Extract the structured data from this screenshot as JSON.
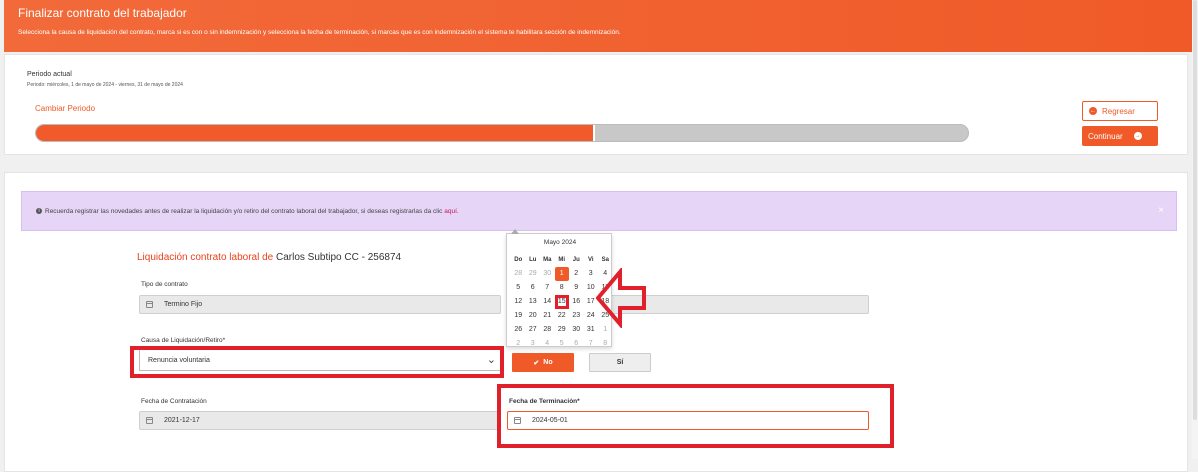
{
  "header": {
    "title": "Finalizar contrato del trabajador",
    "subtitle": "Selecciona la causa de liquidación del contrato, marca si es con o sin indemnización y selecciona la fecha de terminación, si marcas que es con indemnización el sistema te habilitara sección de indemnización."
  },
  "periodo": {
    "label": "Periodo actual",
    "range": "Periodo: miércoles, 1 de mayo de 2024 - viernes, 31 de mayo de 2024",
    "cambiar": "Cambiar Periodo",
    "progress_fraction": 0.6
  },
  "actions": {
    "regresar": "Regresar",
    "continuar": "Continuar"
  },
  "notice": {
    "text": "Recuerda registrar las novedades antes de realizar la liquidación y/o retiro del contrato laboral del trabajador, si deseas registrarlas da clic ",
    "link": "aquí",
    "tail": ".",
    "close": "×"
  },
  "liquidacion": {
    "title_prefix": "Liquidación contrato laboral de",
    "worker": "Carlos Subtipo CC - 256874"
  },
  "form": {
    "tipo_label": "Tipo de contrato",
    "tipo_value": "Termino Fijo",
    "causa_label": "Causa de Liquidación/Retiro*",
    "causa_value": "Renuncia voluntaria",
    "no_label": "No",
    "si_label": "Sí",
    "contratacion_label": "Fecha de Contratación",
    "contratacion_value": "2021-12-17",
    "terminacion_label": "Fecha de Terminación*",
    "terminacion_value": "2024-05-01"
  },
  "calendar": {
    "month": "Mayo 2024",
    "weekdays": [
      "Do",
      "Lu",
      "Ma",
      "Mi",
      "Ju",
      "Vi",
      "Sa"
    ],
    "days": [
      [
        "28",
        "29",
        "30",
        "1",
        "2",
        "3",
        "4"
      ],
      [
        "5",
        "6",
        "7",
        "8",
        "9",
        "10",
        "11"
      ],
      [
        "12",
        "13",
        "14",
        "15",
        "16",
        "17",
        "18"
      ],
      [
        "19",
        "20",
        "21",
        "22",
        "23",
        "24",
        "25"
      ],
      [
        "26",
        "27",
        "28",
        "29",
        "30",
        "31",
        "1"
      ],
      [
        "2",
        "3",
        "4",
        "5",
        "6",
        "7",
        "8"
      ]
    ],
    "selected": "1",
    "highlighted": "15"
  },
  "colors": {
    "brand": "#f05a28",
    "annotation": "#e0202a",
    "notice_bg": "#e6d5f7"
  }
}
